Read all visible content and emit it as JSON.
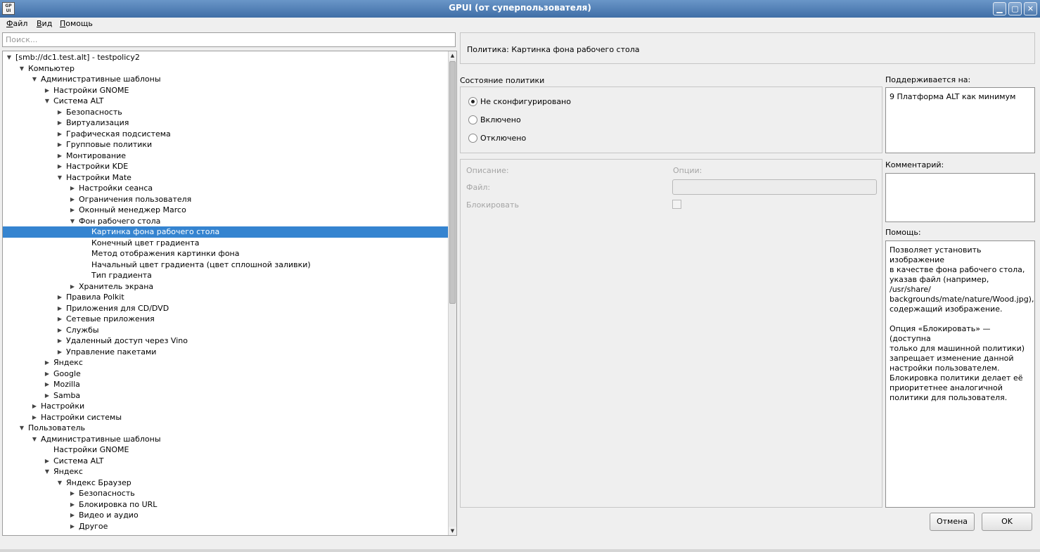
{
  "window": {
    "icon_text": "GP\nUI",
    "title": "GPUI (от суперпользователя)",
    "buttons": {
      "minimize": "▁",
      "maximize": "▢",
      "close": "✕"
    }
  },
  "menu": [
    {
      "label": "Файл",
      "u": "Ф",
      "rest": "айл"
    },
    {
      "label": "Вид",
      "u": "В",
      "rest": "ид"
    },
    {
      "label": "Помощь",
      "u": "П",
      "rest": "омощь"
    }
  ],
  "search": {
    "placeholder": "Поиск...",
    "value": ""
  },
  "tree": [
    {
      "level": 0,
      "arrow": "down",
      "label": "[smb://dc1.test.alt] - testpolicy2"
    },
    {
      "level": 1,
      "arrow": "down",
      "label": "Компьютер"
    },
    {
      "level": 2,
      "arrow": "down",
      "label": "Административные шаблоны"
    },
    {
      "level": 3,
      "arrow": "right",
      "label": "Настройки GNOME"
    },
    {
      "level": 3,
      "arrow": "down",
      "label": "Система ALT"
    },
    {
      "level": 4,
      "arrow": "right",
      "label": "Безопасность"
    },
    {
      "level": 4,
      "arrow": "right",
      "label": "Виртуализация"
    },
    {
      "level": 4,
      "arrow": "right",
      "label": "Графическая подсистема"
    },
    {
      "level": 4,
      "arrow": "right",
      "label": "Групповые политики"
    },
    {
      "level": 4,
      "arrow": "right",
      "label": "Монтирование"
    },
    {
      "level": 4,
      "arrow": "right",
      "label": "Настройки KDE"
    },
    {
      "level": 4,
      "arrow": "down",
      "label": "Настройки Mate"
    },
    {
      "level": 5,
      "arrow": "right",
      "label": "Настройки сеанса"
    },
    {
      "level": 5,
      "arrow": "right",
      "label": "Ограничения пользователя"
    },
    {
      "level": 5,
      "arrow": "right",
      "label": "Оконный менеджер Marco"
    },
    {
      "level": 5,
      "arrow": "down",
      "label": "Фон рабочего стола"
    },
    {
      "level": 6,
      "arrow": "none",
      "label": "Картинка фона рабочего стола",
      "selected": true
    },
    {
      "level": 6,
      "arrow": "none",
      "label": "Конечный цвет градиента"
    },
    {
      "level": 6,
      "arrow": "none",
      "label": "Метод отображения картинки фона"
    },
    {
      "level": 6,
      "arrow": "none",
      "label": "Начальный цвет градиента (цвет сплошной заливки)"
    },
    {
      "level": 6,
      "arrow": "none",
      "label": "Тип градиента"
    },
    {
      "level": 5,
      "arrow": "right",
      "label": "Хранитель экрана"
    },
    {
      "level": 4,
      "arrow": "right",
      "label": "Правила Polkit"
    },
    {
      "level": 4,
      "arrow": "right",
      "label": "Приложения для CD/DVD"
    },
    {
      "level": 4,
      "arrow": "right",
      "label": "Сетевые приложения"
    },
    {
      "level": 4,
      "arrow": "right",
      "label": "Службы"
    },
    {
      "level": 4,
      "arrow": "right",
      "label": "Удаленный доступ через Vino"
    },
    {
      "level": 4,
      "arrow": "right",
      "label": "Управление пакетами"
    },
    {
      "level": 3,
      "arrow": "right",
      "label": "Яндекс"
    },
    {
      "level": 3,
      "arrow": "right",
      "label": "Google"
    },
    {
      "level": 3,
      "arrow": "right",
      "label": "Mozilla"
    },
    {
      "level": 3,
      "arrow": "right",
      "label": "Samba"
    },
    {
      "level": 2,
      "arrow": "right",
      "label": "Настройки"
    },
    {
      "level": 2,
      "arrow": "right",
      "label": "Настройки системы"
    },
    {
      "level": 1,
      "arrow": "down",
      "label": "Пользователь"
    },
    {
      "level": 2,
      "arrow": "down",
      "label": "Административные шаблоны"
    },
    {
      "level": 3,
      "arrow": "none",
      "label": "Настройки GNOME"
    },
    {
      "level": 3,
      "arrow": "right",
      "label": "Система ALT"
    },
    {
      "level": 3,
      "arrow": "down",
      "label": "Яндекс"
    },
    {
      "level": 4,
      "arrow": "down",
      "label": "Яндекс Браузер"
    },
    {
      "level": 5,
      "arrow": "right",
      "label": "Безопасность"
    },
    {
      "level": 5,
      "arrow": "right",
      "label": "Блокировка по URL"
    },
    {
      "level": 5,
      "arrow": "right",
      "label": "Видео и аудио"
    },
    {
      "level": 5,
      "arrow": "right",
      "label": "Другое"
    }
  ],
  "policy": {
    "header": "Политика: Картинка фона рабочего стола",
    "state_label": "Состояние политики",
    "states": [
      {
        "label": "Не сконфигурировано",
        "checked": true
      },
      {
        "label": "Включено",
        "checked": false
      },
      {
        "label": "Отключено",
        "checked": false
      }
    ],
    "description_label": "Описание:",
    "options_label": "Опции:",
    "file_label": "Файл:",
    "file_value": "",
    "lock_label": "Блокировать",
    "lock_checked": false
  },
  "side": {
    "supported_label": "Поддерживается на:",
    "supported_value": "9 Платформа ALT как минимум",
    "comment_label": "Комментарий:",
    "comment_value": "",
    "help_label": "Помощь:",
    "help_text": "Позволяет установить изображение\nв качестве фона рабочего стола,\nуказав файл (например, /usr/share/\nbackgrounds/mate/nature/Wood.jpg),\nсодержащий изображение.\n\nОпция «Блокировать» — (доступна\nтолько для машинной политики)\nзапрещает изменение данной\nнастройки пользователем.\nБлокировка политики делает её\nприоритетнее аналогичной\nполитики для пользователя."
  },
  "buttons": {
    "cancel": "Отмена",
    "ok": "OK"
  },
  "colors": {
    "selection": "#3584d0",
    "titlebar": "#4f7fb5"
  }
}
